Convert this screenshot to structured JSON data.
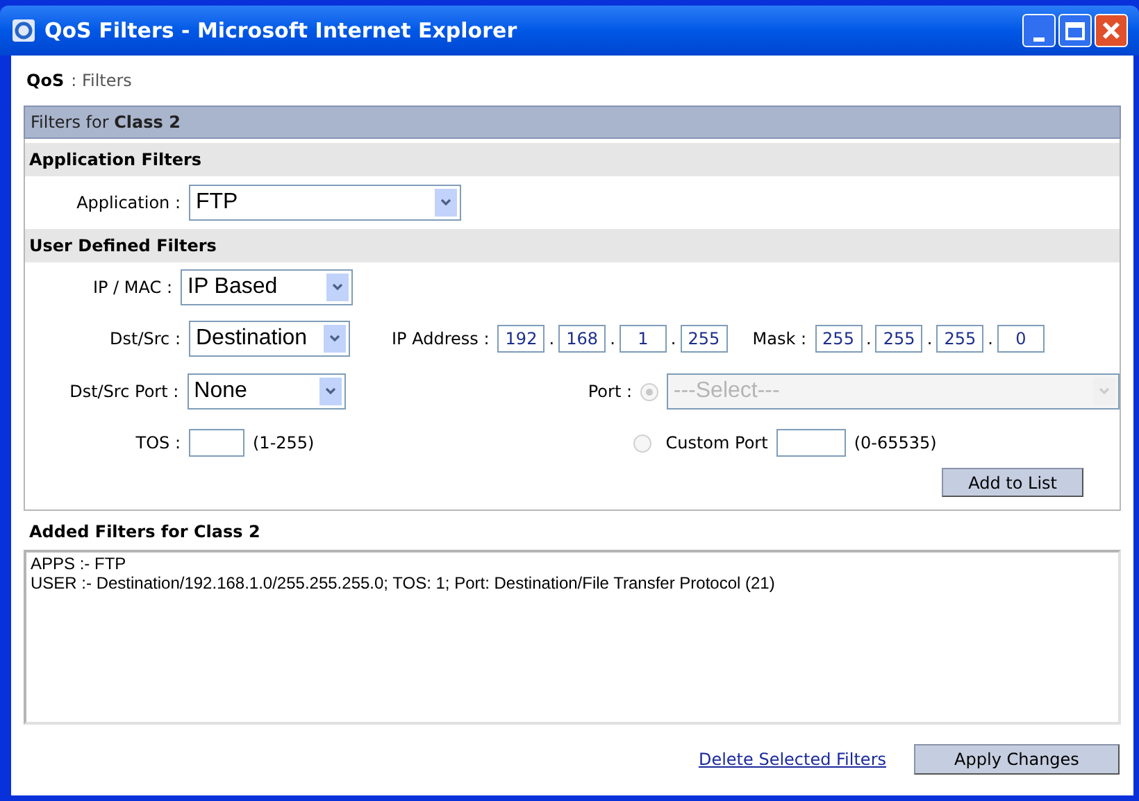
{
  "window": {
    "title": "QoS Filters - Microsoft Internet Explorer"
  },
  "breadcrumb": {
    "section": "QoS",
    "page": ": Filters"
  },
  "header": "Filters for **Class 2**",
  "application_filters": {
    "title": "Application Filters",
    "label": "Application :",
    "value": "FTP"
  },
  "user_defined_filters": {
    "title": "User Defined Filters",
    "ip_mac": {
      "label": "IP / MAC :",
      "value": "IP Based"
    },
    "dst_src": {
      "label": "Dst/Src :",
      "value": "Destination"
    },
    "ip_address": {
      "label": "IP Address :",
      "octets": [
        "192",
        "168",
        "1",
        "255"
      ],
      "separators": [
        ".",
        ".",
        "."
      ]
    },
    "mask": {
      "label": "Mask :",
      "octets": [
        "255",
        "255",
        "255",
        "0"
      ],
      "separators": [
        ".",
        ".",
        "."
      ]
    },
    "dst_src_port": {
      "label": "Dst/Src Port :",
      "value": "None"
    },
    "port": {
      "label": "Port :",
      "selected": true,
      "disabled": true,
      "value": "---Select---"
    },
    "tos": {
      "label": "TOS :",
      "hint": "(1-255)"
    },
    "custom_port": {
      "label": "Custom Port",
      "selected": false,
      "hint": "(0-65535)"
    },
    "add_button": "Add to List"
  },
  "added_filters": {
    "title": "Added Filters for Class 2",
    "lines": [
      "APPS :- FTP",
      "USER :- Destination/192.168.1.0/255.255.255.0; TOS: 1; Port: Destination/File Transfer Protocol (21)"
    ]
  },
  "footer": {
    "delete_link": "Delete Selected Filters",
    "apply_button": "Apply Changes"
  }
}
